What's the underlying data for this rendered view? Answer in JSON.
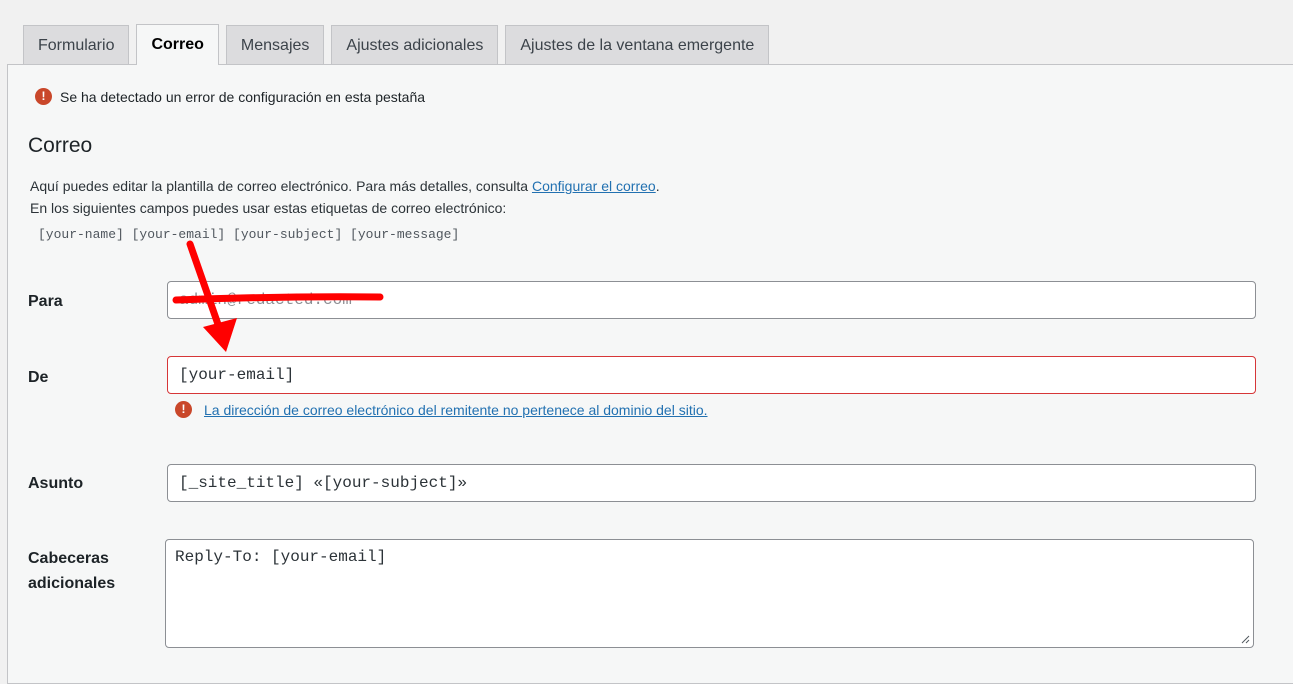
{
  "tabs": [
    {
      "label": "Formulario",
      "active": false
    },
    {
      "label": "Correo",
      "active": true
    },
    {
      "label": "Mensajes",
      "active": false
    },
    {
      "label": "Ajustes adicionales",
      "active": false
    },
    {
      "label": "Ajustes de la ventana emergente",
      "active": false
    }
  ],
  "config_error": {
    "icon": "!",
    "text": "Se ha detectado un error de configuración en esta pestaña"
  },
  "section": {
    "title": "Correo",
    "desc_line1": "Aquí puedes editar la plantilla de correo electrónico. Para más detalles, consulta ",
    "desc_link": "Configurar el correo",
    "desc_line1_end": ".",
    "desc_line2": "En los siguientes campos puedes usar estas etiquetas de correo electrónico:",
    "tags": "[your-name] [your-email] [your-subject] [your-message]"
  },
  "fields": {
    "para": {
      "label": "Para",
      "value": "admin@redacted.com"
    },
    "de": {
      "label": "De",
      "value": "[your-email]",
      "error_icon": "!",
      "error_text": "La dirección de correo electrónico del remitente no pertenece al dominio del sitio."
    },
    "asunto": {
      "label": "Asunto",
      "value": "[_site_title] «[your-subject]»"
    },
    "cabeceras": {
      "label_line1": "Cabeceras",
      "label_line2": "adicionales",
      "value": "Reply-To: [your-email]"
    }
  },
  "colors": {
    "error": "#c9472a",
    "link": "#2271b1",
    "annotation": "#ff0000"
  }
}
